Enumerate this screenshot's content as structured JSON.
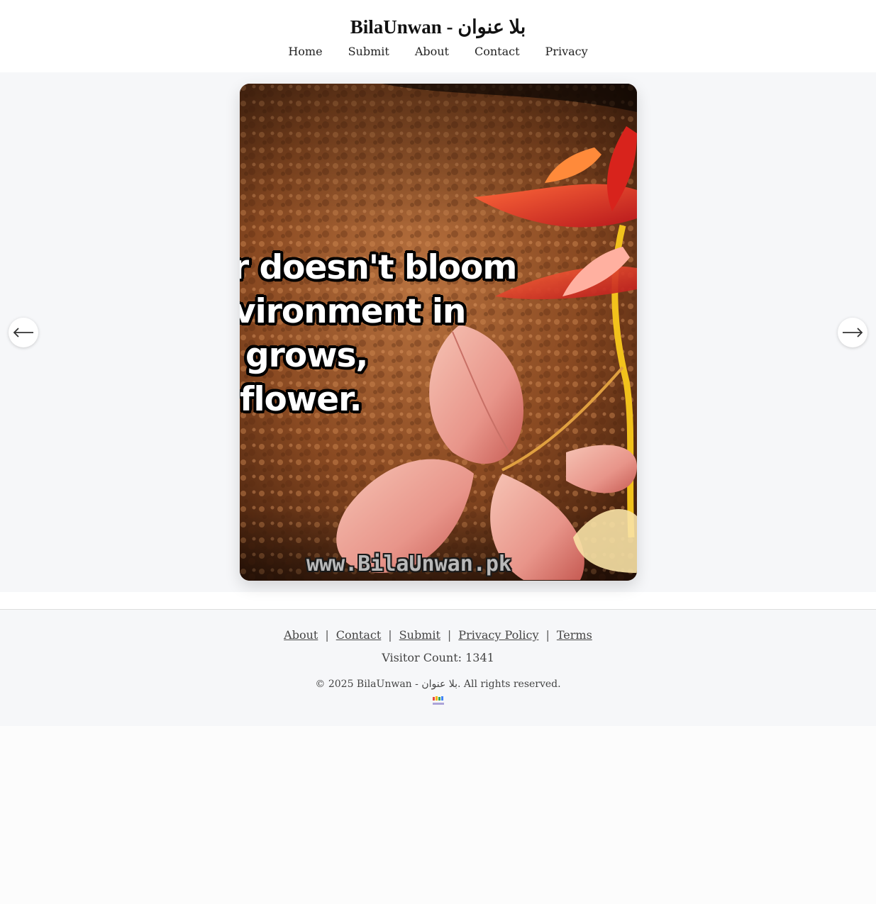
{
  "header": {
    "title": "BilaUnwan - بلا عنوان",
    "nav": [
      {
        "label": "Home"
      },
      {
        "label": "Submit"
      },
      {
        "label": "About"
      },
      {
        "label": "Contact"
      },
      {
        "label": "Privacy"
      }
    ]
  },
  "viewer": {
    "quote_lines": [
      "r doesn't bloom",
      "vironment  in",
      " grows,",
      "flower."
    ],
    "watermark": "www.BilaUnwan.pk",
    "prev_icon": "arrow-left-icon",
    "next_icon": "arrow-right-icon"
  },
  "footer": {
    "links": [
      {
        "label": "About"
      },
      {
        "label": "Contact"
      },
      {
        "label": "Submit"
      },
      {
        "label": "Privacy Policy"
      },
      {
        "label": "Terms"
      }
    ],
    "separator": "|",
    "visitor_count": "Visitor Count: 1341",
    "copyright": "© 2025 BilaUnwan - بلا عنوان. All rights reserved.",
    "logo_icon": "bilaunwan-logo-icon"
  },
  "colors": {
    "page_bg": "#fcfcfc",
    "viewer_bg": "#f6f7f9",
    "header_bg": "#ffffff"
  }
}
